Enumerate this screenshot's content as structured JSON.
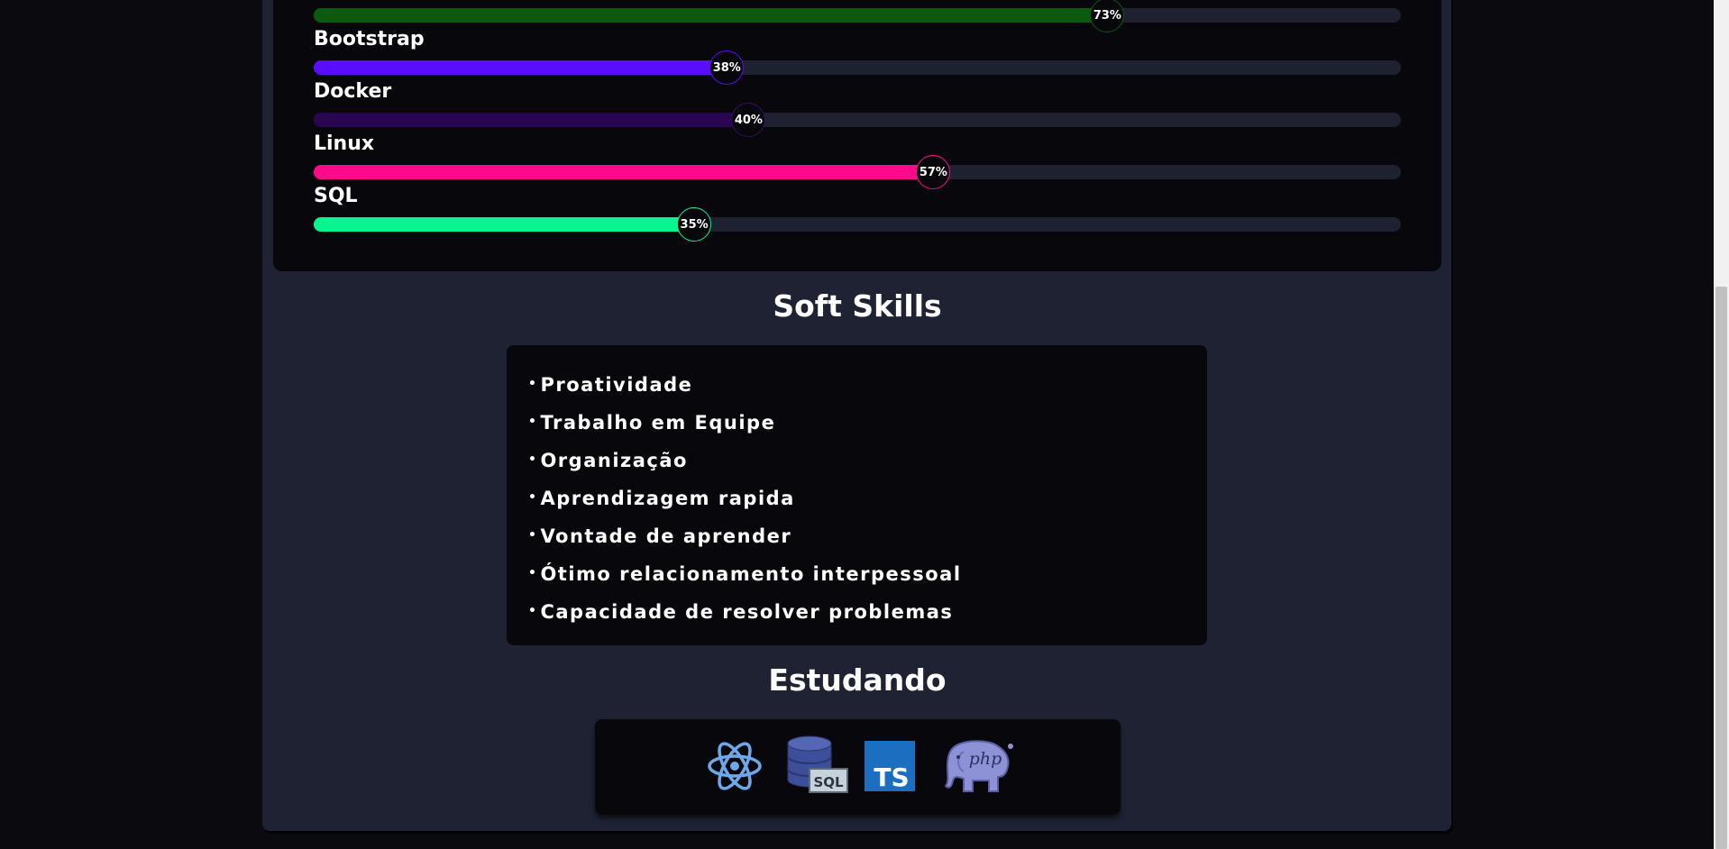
{
  "hard_skills": [
    {
      "name": "",
      "percent": 73,
      "percent_label": "73%",
      "color": "#0b5a10",
      "ring_color": "#0b5a10"
    },
    {
      "name": "Bootstrap",
      "percent": 38,
      "percent_label": "38%",
      "color": "#5a0dfa",
      "ring_color": "#5a0dfa"
    },
    {
      "name": "Docker",
      "percent": 40,
      "percent_label": "40%",
      "color": "#2a0652",
      "ring_color": "#3a0a6a"
    },
    {
      "name": "Linux",
      "percent": 57,
      "percent_label": "57%",
      "color": "#ff0a8a",
      "ring_color": "#ff0a8a"
    },
    {
      "name": "SQL",
      "percent": 35,
      "percent_label": "35%",
      "color": "#06f58e",
      "ring_color": "#06f58e"
    }
  ],
  "soft_skills": {
    "title": "Soft Skills",
    "bullet": "•",
    "items": [
      "Proatividade",
      "Trabalho em Equipe",
      "Organização",
      "Aprendizagem rapida",
      "Vontade de aprender",
      "Ótimo relacionamento interpessoal",
      "Capacidade de resolver problemas"
    ]
  },
  "studying": {
    "title": "Estudando",
    "icons": [
      "react-icon",
      "sql-database-icon",
      "typescript-icon",
      "php-elephant-icon"
    ],
    "sql_text": "SQL",
    "ts_text": "TS",
    "php_text": "php"
  },
  "colors": {
    "page_bg": "#0b0b0f",
    "card_bg": "#1f2233",
    "panel_bg": "#08080c",
    "track": "#1e2130"
  }
}
